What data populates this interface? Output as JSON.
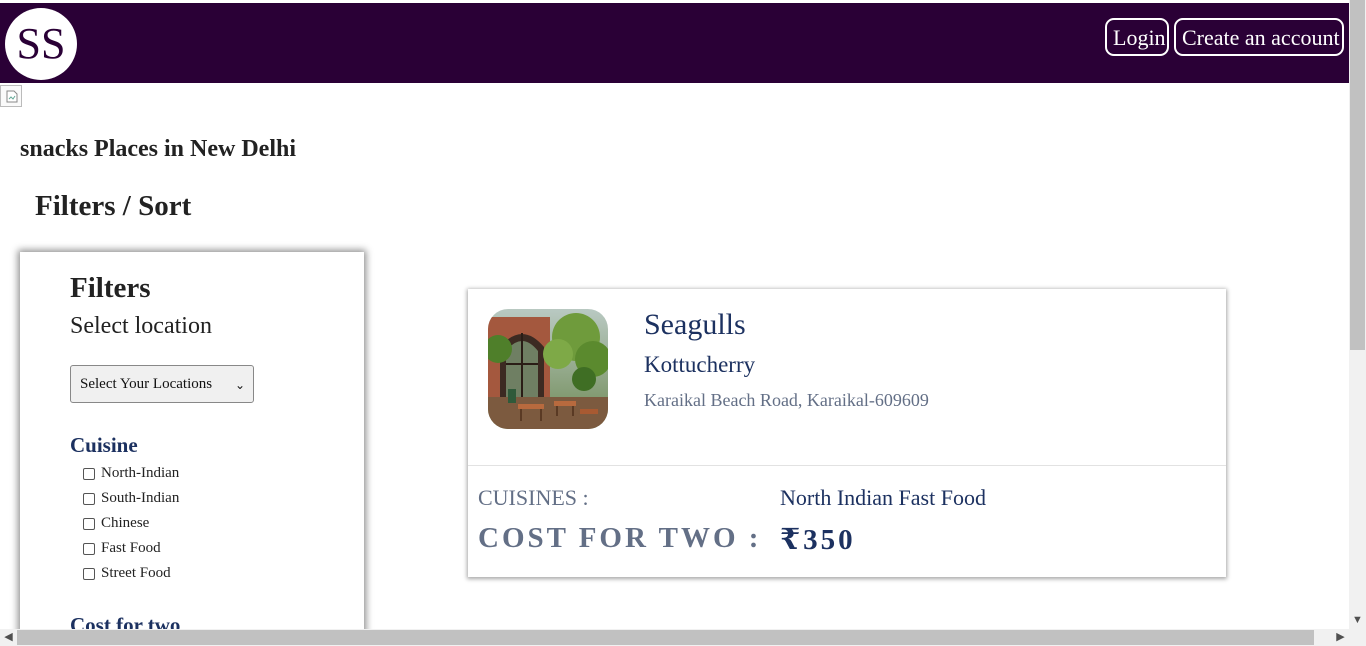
{
  "header": {
    "logo_text": "SS",
    "login_label": "Login",
    "signup_label": "Create an account",
    "bg_color": "#2a0036"
  },
  "page": {
    "title": "snacks Places in New Delhi",
    "filters_sort_title": "Filters / Sort"
  },
  "filters": {
    "heading": "Filters",
    "location_label": "Select location",
    "location_select": "Select Your Locations",
    "cuisine_heading": "Cuisine",
    "cuisines": [
      {
        "label": "North-Indian",
        "checked": false
      },
      {
        "label": "South-Indian",
        "checked": false
      },
      {
        "label": "Chinese",
        "checked": false
      },
      {
        "label": "Fast Food",
        "checked": false
      },
      {
        "label": "Street Food",
        "checked": false
      }
    ],
    "cost_heading": "Cost for two"
  },
  "restaurant": {
    "name": "Seagulls",
    "locality": "Kottucherry",
    "address": "Karaikal Beach Road, Karaikal-609609",
    "cuisines_label": "CUISINES :",
    "cuisines_value": "North Indian Fast Food",
    "cost_label": "COST FOR TWO :",
    "cost_value": "₹350"
  }
}
